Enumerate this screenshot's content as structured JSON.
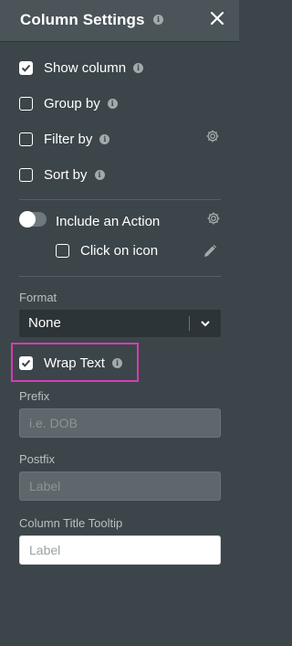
{
  "panel": {
    "title": "Column Settings"
  },
  "options": {
    "show_column": {
      "label": "Show column",
      "checked": true
    },
    "group_by": {
      "label": "Group by",
      "checked": false
    },
    "filter_by": {
      "label": "Filter by",
      "checked": false
    },
    "sort_by": {
      "label": "Sort by",
      "checked": false
    },
    "include_action": {
      "label": "Include an Action",
      "on": false
    },
    "click_on_icon": {
      "label": "Click on icon",
      "checked": false
    },
    "wrap_text": {
      "label": "Wrap Text",
      "checked": true
    }
  },
  "format": {
    "label": "Format",
    "value": "None"
  },
  "prefix": {
    "label": "Prefix",
    "placeholder": "i.e. DOB"
  },
  "postfix": {
    "label": "Postfix",
    "placeholder": "Label"
  },
  "tooltip": {
    "label": "Column Title Tooltip",
    "placeholder": "Label"
  },
  "colors": {
    "panel_bg": "#3c4549",
    "header_bg": "#4a5459",
    "highlight": "#d63bb5"
  },
  "icons": [
    "info-icon",
    "close-icon",
    "check-icon",
    "gear-icon",
    "pencil-icon",
    "chevron-down-icon"
  ]
}
